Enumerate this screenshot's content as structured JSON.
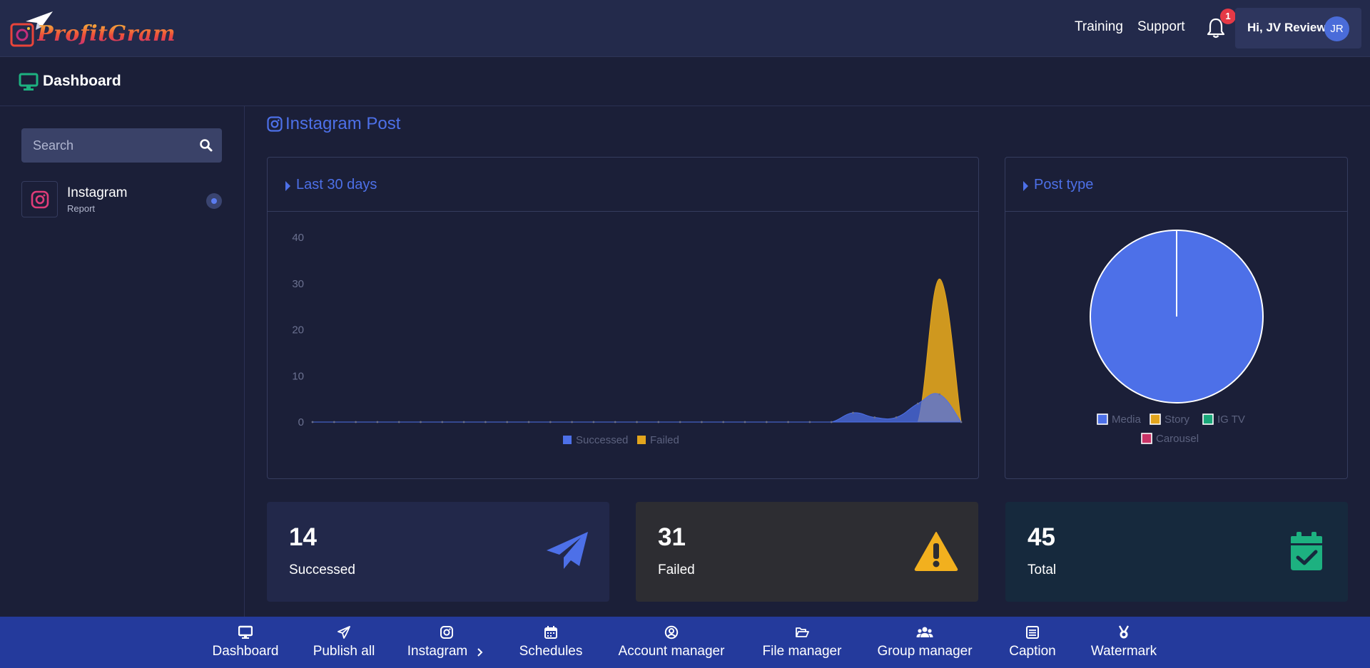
{
  "header": {
    "logo_text": "ProfitGram",
    "links": [
      "Training",
      "Support"
    ],
    "notification_count": "1",
    "user_greeting": "Hi, JV Review",
    "avatar_initials": "JR"
  },
  "subheader": {
    "title": "Dashboard"
  },
  "sidebar": {
    "search_placeholder": "Search",
    "items": [
      {
        "label": "Instagram",
        "sublabel": "Report"
      }
    ]
  },
  "main": {
    "section_title": "Instagram Post",
    "line_card_title": "Last 30 days",
    "pie_card_title": "Post type"
  },
  "chart_data": [
    {
      "type": "area",
      "title": "Last 30 days",
      "ylim": [
        0,
        40
      ],
      "yticks": [
        "0",
        "10",
        "20",
        "30",
        "40"
      ],
      "x_count": 30,
      "grid": false,
      "legend_position": "bottom",
      "series": [
        {
          "name": "Successed",
          "color": "#4d70e8",
          "values": [
            0,
            0,
            0,
            0,
            0,
            0,
            0,
            0,
            0,
            0,
            0,
            0,
            0,
            0,
            0,
            0,
            0,
            0,
            0,
            0,
            0,
            0,
            0,
            0,
            0,
            2,
            1,
            1,
            4,
            6,
            0
          ]
        },
        {
          "name": "Failed",
          "color": "#e3a51d",
          "values": [
            0,
            0,
            0,
            0,
            0,
            0,
            0,
            0,
            0,
            0,
            0,
            0,
            0,
            0,
            0,
            0,
            0,
            0,
            0,
            0,
            0,
            0,
            0,
            0,
            0,
            0,
            0,
            0,
            0,
            31,
            0
          ]
        }
      ]
    },
    {
      "type": "pie",
      "title": "Post type",
      "legend_position": "bottom",
      "labels": [
        "Media",
        "Story",
        "IG TV",
        "Carousel"
      ],
      "values": [
        100,
        0,
        0,
        0
      ],
      "colors": [
        "#4d70e8",
        "#e3a51d",
        "#1aa87a",
        "#c93467"
      ]
    }
  ],
  "stats": [
    {
      "value": "14",
      "label": "Successed",
      "icon": "paper-plane-icon",
      "bg": "#22284a",
      "color": "#4d70e8"
    },
    {
      "value": "31",
      "label": "Failed",
      "icon": "warning-icon",
      "bg": "#2d2d32",
      "color": "#f2b01e"
    },
    {
      "value": "45",
      "label": "Total",
      "icon": "calendar-check-icon",
      "bg": "#16293d",
      "color": "#1db180"
    }
  ],
  "bottom_nav": [
    {
      "label": "Dashboard",
      "icon": "monitor-icon"
    },
    {
      "label": "Publish all",
      "icon": "paper-plane-icon"
    },
    {
      "label": "Instagram",
      "icon": "instagram-icon"
    },
    {
      "label": "Schedules",
      "icon": "calendar-icon"
    },
    {
      "label": "Account manager",
      "icon": "user-circle-icon"
    },
    {
      "label": "File manager",
      "icon": "folder-open-icon"
    },
    {
      "label": "Group manager",
      "icon": "users-icon"
    },
    {
      "label": "Caption",
      "icon": "list-icon"
    },
    {
      "label": "Watermark",
      "icon": "medal-icon"
    }
  ],
  "colors": {
    "accent": "#4d70e8",
    "nav_bg": "#243a9c",
    "page_bg": "#1b1f38"
  }
}
